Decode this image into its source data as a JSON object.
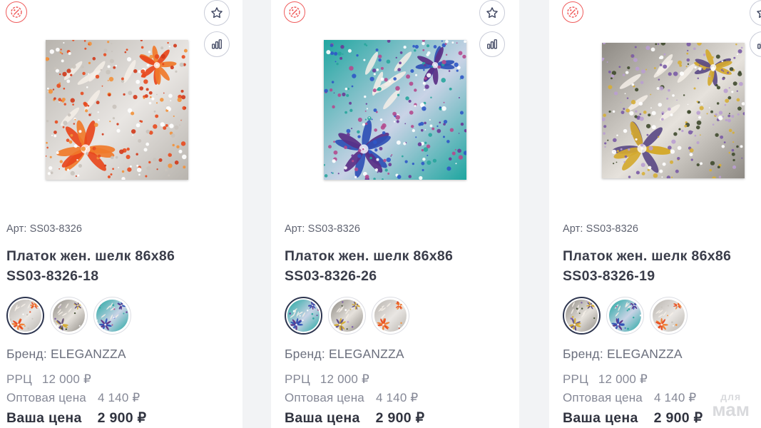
{
  "colors": {
    "accent_red": "#ef5b5b",
    "text_dark": "#3a3d4a",
    "text_muted": "#858896",
    "swatch_active_border": "#2e3650"
  },
  "icons": {
    "discount": "discount-percent-icon",
    "favorite": "star-icon",
    "compare": "bar-chart-icon"
  },
  "products": [
    {
      "article": "Арт: SS03-8326",
      "title_line1": "Платок жен. шелк 86х86",
      "title_line2": "SS03-8326-18",
      "brand": "Бренд: ELEGANZZA",
      "rrc_label": "РРЦ",
      "rrc_value": "12 000 ₽",
      "wholesale_label": "Оптовая цена",
      "wholesale_value": "4 140 ₽",
      "your_price_label": "Ваша цена",
      "your_price_value": "2 900 ₽",
      "palette": "orange",
      "swatches": [
        "orange",
        "gold",
        "teal"
      ]
    },
    {
      "article": "Арт: SS03-8326",
      "title_line1": "Платок жен. шелк 86х86",
      "title_line2": "SS03-8326-26",
      "brand": "Бренд: ELEGANZZA",
      "rrc_label": "РРЦ",
      "rrc_value": "12 000 ₽",
      "wholesale_label": "Оптовая цена",
      "wholesale_value": "4 140 ₽",
      "your_price_label": "Ваша цена",
      "your_price_value": "2 900 ₽",
      "palette": "teal",
      "swatches": [
        "teal",
        "gold",
        "orange"
      ]
    },
    {
      "article": "Арт: SS03-8326",
      "title_line1": "Платок жен. шелк 86х86",
      "title_line2": "SS03-8326-19",
      "brand": "Бренд: ELEGANZZA",
      "rrc_label": "РРЦ",
      "rrc_value": "12 000 ₽",
      "wholesale_label": "Оптовая цена",
      "wholesale_value": "4 140 ₽",
      "your_price_label": "Ваша цена",
      "your_price_value": "2 900 ₽",
      "palette": "gold",
      "swatches": [
        "gold",
        "teal",
        "orange"
      ]
    }
  ],
  "palettes": {
    "orange": {
      "bg1": "#b8b4ae",
      "bg2": "#e9e6e3",
      "flower": "#e8471c",
      "flower2": "#f07a2a",
      "dots": [
        "#e84a1e",
        "#f2913a",
        "#c9c3bd",
        "#ffffff",
        "#d2381a"
      ]
    },
    "teal": {
      "bg1": "#1fa6a0",
      "bg2": "#c9d3e6",
      "flower": "#5a2f86",
      "flower2": "#2f50b5",
      "dots": [
        "#6a3a96",
        "#2f58c6",
        "#28a59c",
        "#b44a8e",
        "#ffffff"
      ]
    },
    "gold": {
      "bg1": "#8e8a84",
      "bg2": "#e6e2dc",
      "flower": "#5b4a86",
      "flower2": "#d4a92f",
      "dots": [
        "#7a5ba6",
        "#d6ae37",
        "#3f4a2e",
        "#ffffff",
        "#b99ed0"
      ]
    }
  },
  "watermark": {
    "small": "для",
    "big": "мам"
  }
}
